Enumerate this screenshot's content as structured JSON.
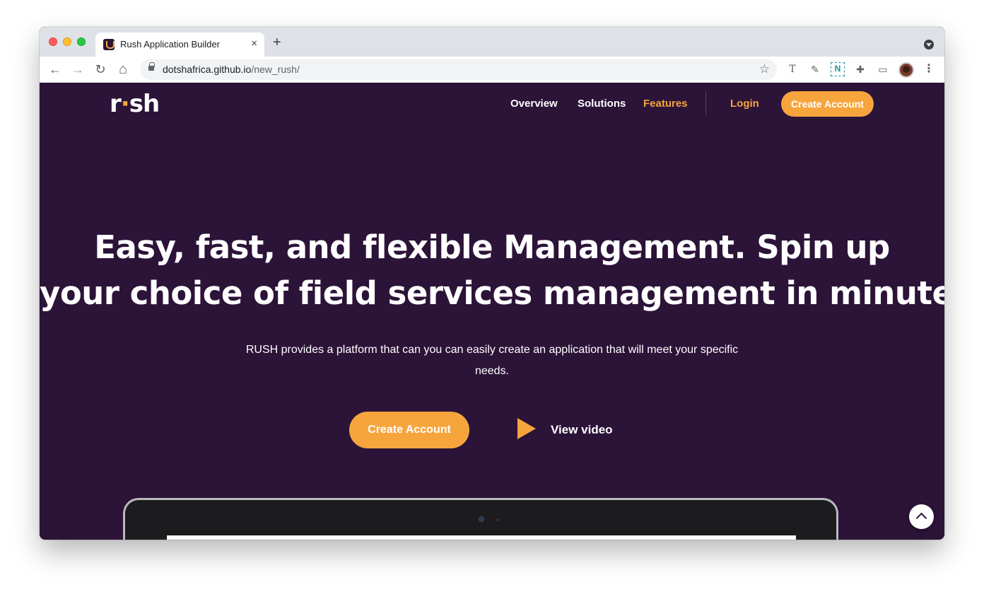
{
  "browser": {
    "tab_title": "Rush Application Builder",
    "tab_close": "×",
    "new_tab": "+",
    "url_host": "dotshafrica.github.io",
    "url_path": "/new_rush/",
    "icons": {
      "back": "←",
      "forward": "→",
      "reload": "↻",
      "home": "⌂",
      "star": "☆",
      "ext_t": "T",
      "ext_dropper": "✎",
      "ext_n": "N",
      "ext_puzzle": "✚",
      "cast": "▭",
      "menu": "⋮"
    }
  },
  "site": {
    "logo_pre": "r",
    "logo_dot": "·",
    "logo_post": "sh",
    "nav": {
      "overview": "Overview",
      "solutions": "Solutions",
      "features": "Features",
      "login": "Login",
      "create_account": "Create Account"
    },
    "hero": {
      "title_line1": "Easy, fast, and flexible Management. Spin up",
      "title_line2": "your choice of field services management in minutes",
      "title_dot": ".",
      "subtitle": "RUSH provides a platform that can you can easily create an application that will meet your specific needs.",
      "cta": "Create Account",
      "video": "View video"
    },
    "colors": {
      "background": "#2c1338",
      "accent": "#f6a53d",
      "text": "#ffffff"
    }
  }
}
